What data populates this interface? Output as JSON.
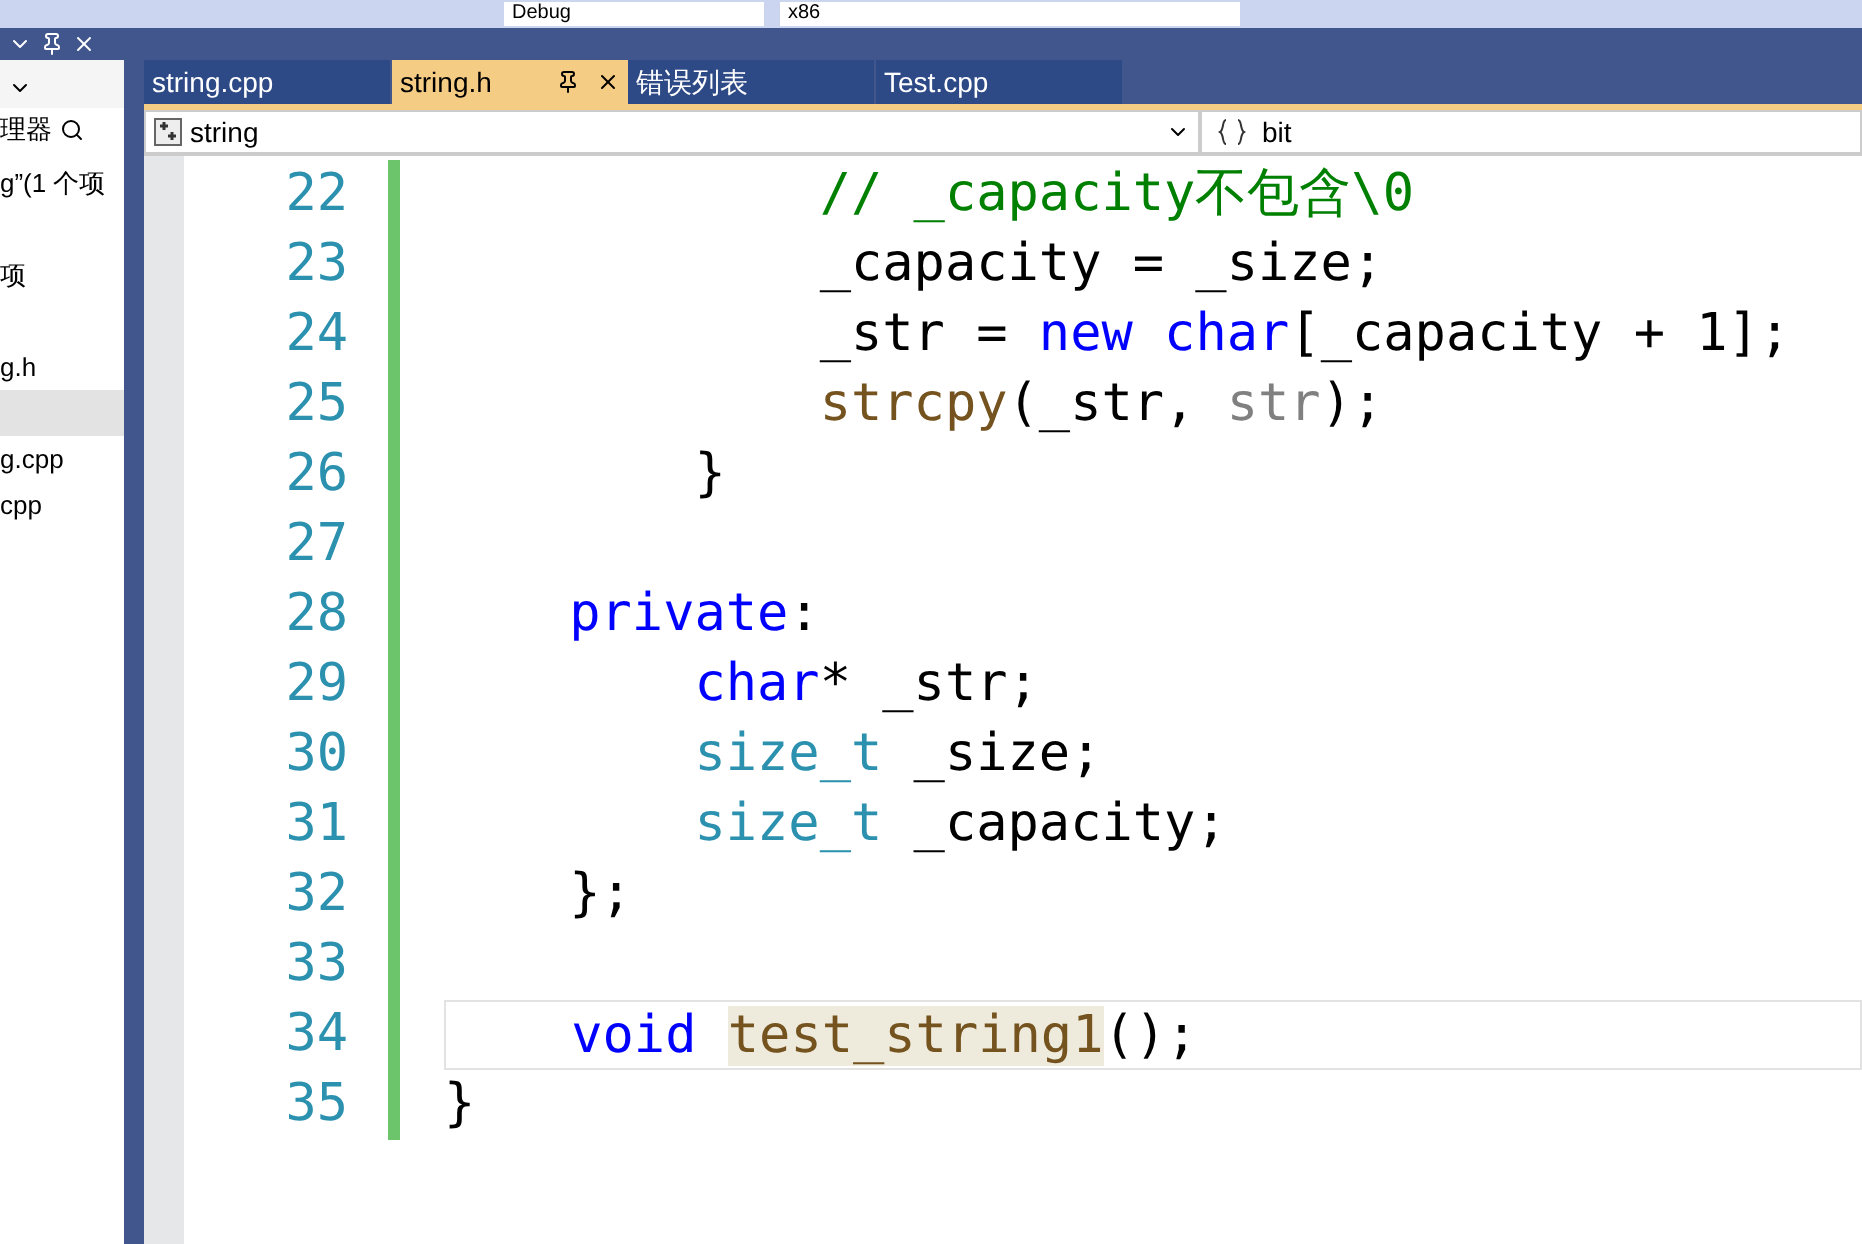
{
  "toolbar": {
    "configuration": "Debug",
    "platform": "x86"
  },
  "solution_explorer": {
    "search_placeholder": "理器",
    "items": [
      {
        "label": "g”(1 个项",
        "selected": false
      },
      {
        "label": "项",
        "selected": false
      },
      {
        "label": "g.h",
        "selected": false
      },
      {
        "selected": true
      },
      {
        "label": "g.cpp",
        "selected": false
      },
      {
        "label": "cpp",
        "selected": false
      }
    ]
  },
  "tabs": [
    {
      "label": "string.cpp",
      "selected": false
    },
    {
      "label": "string.h",
      "selected": true
    },
    {
      "label": "错误列表",
      "selected": false
    },
    {
      "label": "Test.cpp",
      "selected": false
    }
  ],
  "navigation": {
    "scope": "string",
    "member": "bit"
  },
  "code_lines": [
    {
      "number": "22",
      "current": false,
      "tokens": [
        {
          "text": "            // _capacity不包含\\0",
          "kind": "comment"
        }
      ]
    },
    {
      "number": "23",
      "current": false,
      "tokens": [
        {
          "text": "            _capacity = _size;",
          "kind": "plain"
        }
      ]
    },
    {
      "number": "24",
      "current": false,
      "tokens": [
        {
          "text": "            _str = ",
          "kind": "plain"
        },
        {
          "text": "new ",
          "kind": "keyword"
        },
        {
          "text": "char",
          "kind": "keyword"
        },
        {
          "text": "[_capacity + 1];",
          "kind": "plain"
        }
      ]
    },
    {
      "number": "25",
      "current": false,
      "tokens": [
        {
          "text": "            strcpy",
          "kind": "function"
        },
        {
          "text": "(_str, ",
          "kind": "plain"
        },
        {
          "text": "str",
          "kind": "parameter"
        },
        {
          "text": ");",
          "kind": "plain"
        }
      ]
    },
    {
      "number": "26",
      "current": false,
      "tokens": [
        {
          "text": "        }",
          "kind": "plain"
        }
      ]
    },
    {
      "number": "27",
      "current": false
    },
    {
      "number": "28",
      "current": false,
      "tokens": [
        {
          "text": "    private",
          "kind": "keyword"
        },
        {
          "text": ":",
          "kind": "plain"
        }
      ]
    },
    {
      "number": "29",
      "current": false,
      "tokens": [
        {
          "text": "        char",
          "kind": "keyword"
        },
        {
          "text": "* _str;",
          "kind": "plain"
        }
      ]
    },
    {
      "number": "30",
      "current": false,
      "tokens": [
        {
          "text": "        size_t",
          "kind": "type"
        },
        {
          "text": " _size;",
          "kind": "plain"
        }
      ]
    },
    {
      "number": "31",
      "current": false,
      "tokens": [
        {
          "text": "        size_t",
          "kind": "type"
        },
        {
          "text": " _capacity;",
          "kind": "plain"
        }
      ]
    },
    {
      "number": "32",
      "current": false,
      "tokens": [
        {
          "text": "    };",
          "kind": "plain"
        }
      ]
    },
    {
      "number": "33",
      "current": false
    },
    {
      "number": "34",
      "current": true,
      "tokens": [
        {
          "text": "    void ",
          "kind": "keyword"
        },
        {
          "text": "test_string1",
          "kind": "highlighted-function"
        },
        {
          "text": "();",
          "kind": "plain"
        }
      ]
    },
    {
      "number": "35",
      "current": false,
      "tokens": [
        {
          "text": "}",
          "kind": "plain"
        }
      ]
    }
  ]
}
